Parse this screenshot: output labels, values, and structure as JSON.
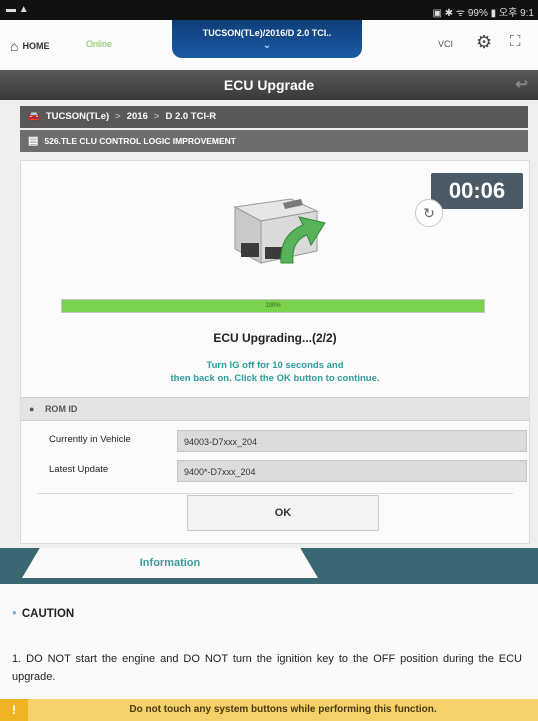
{
  "status_bar": {
    "left": "▬ ▲",
    "right": "▣ ✱ ᯤ 99% ▮ 오후 9:1"
  },
  "top_bar": {
    "home_label": "HOME",
    "online_label": "Online",
    "vehicle_tab": "TUCSON(TLe)/2016/D 2.0 TCI..",
    "vci_label": "VCI",
    "home_icon": "home-icon",
    "settings_icon": "gear-icon",
    "expand_icon": "expand-icon"
  },
  "title": "ECU Upgrade",
  "breadcrumb": {
    "model": "TUCSON(TLe)",
    "year": "2016",
    "engine": "D 2.0 TCI-R",
    "separator": ">"
  },
  "update_description": "526.TLE CLU CONTROL LOGIC IMPROVEMENT",
  "timer": "00:06",
  "progress": {
    "percent_label": "100%",
    "value": 1.0
  },
  "upgrade_status": "ECU Upgrading...(2/2)",
  "instruction_line1": "Turn IG off for 10 seconds and",
  "instruction_line2": "then back on. Click the OK button to continue.",
  "rom": {
    "header": "ROM ID",
    "rows": [
      {
        "label": "Currently in Vehicle",
        "value": "94003-D7xxx_204"
      },
      {
        "label": "Latest Update",
        "value": "9400*-D7xxx_204"
      }
    ]
  },
  "ok_label": "OK",
  "info_tab": "Information",
  "caution_title": "CAUTION",
  "caution_text": "1. DO NOT start the engine and DO NOT turn the ignition key to the OFF position during the ECU upgrade.",
  "warning_icon": "!",
  "warning_text": "Do not touch any system buttons while performing this function.",
  "colors": {
    "accent_teal": "#3a6872",
    "progress_green": "#7bd24c",
    "warning_yellow": "#f5d169",
    "tab_blue": "#1b5aa3"
  }
}
